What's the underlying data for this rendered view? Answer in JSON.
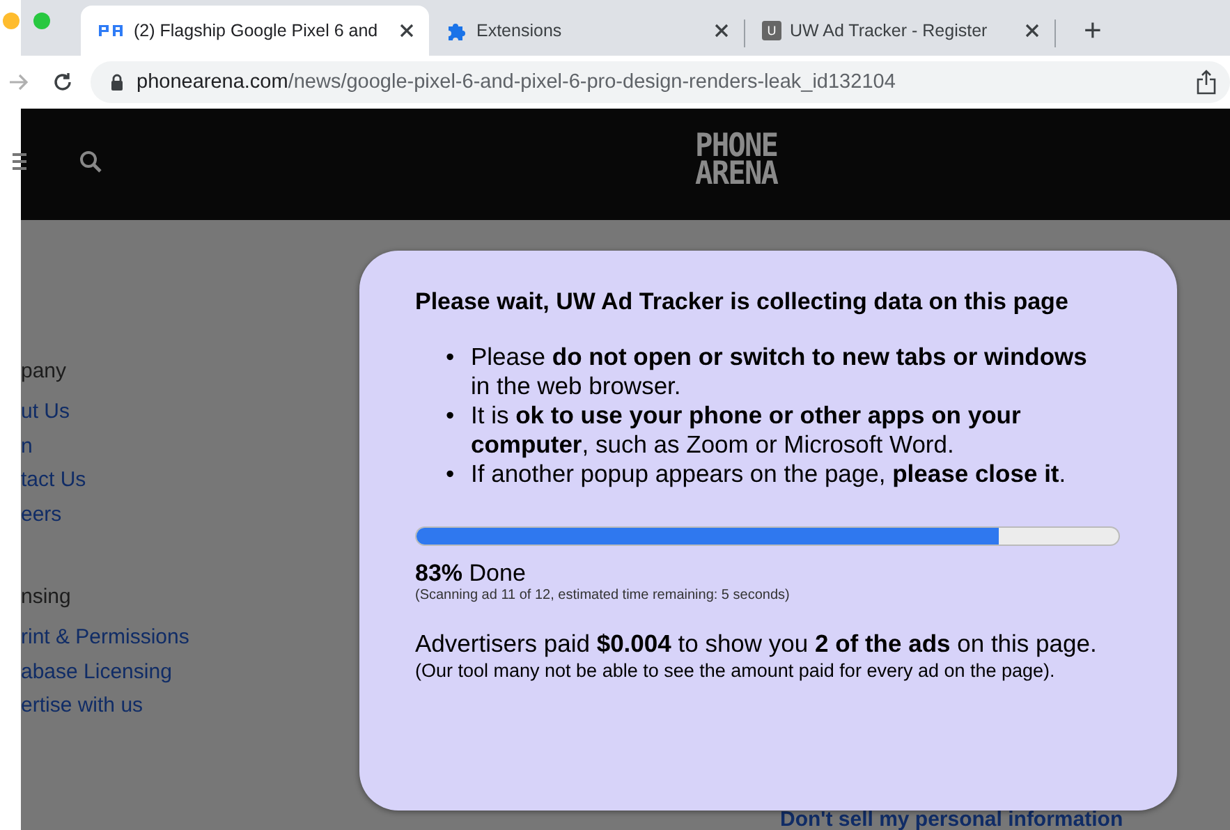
{
  "browser": {
    "window_buttons": [
      {
        "color": "#febc2e"
      },
      {
        "color": "#28c840"
      }
    ],
    "tabs": [
      {
        "title": "(2) Flagship Google Pixel 6 and",
        "selected": true,
        "kind": "site"
      },
      {
        "title": "Extensions",
        "selected": false,
        "kind": "extensions"
      },
      {
        "title": "UW Ad Tracker - Register",
        "selected": false,
        "kind": "letter",
        "badge": "U"
      }
    ],
    "new_tab": "+",
    "address": {
      "host": "phonearena.com",
      "path": "/news/google-pixel-6-and-pixel-6-pro-design-renders-leak_id132104"
    }
  },
  "site": {
    "logo": [
      "PHONE",
      "ARENA"
    ],
    "sidebar": [
      {
        "heading": "pany",
        "links": [
          "ut Us",
          "n",
          "tact Us",
          "eers"
        ]
      },
      {
        "heading": "nsing",
        "links": [
          "rint & Permissions",
          "abase Licensing",
          "ertise with us"
        ]
      }
    ],
    "footer_link": "Don't sell my personal information"
  },
  "popup": {
    "title": "Please wait, UW Ad Tracker is collecting data on this page",
    "marker": "•",
    "bullets": [
      "Please **do not open or switch to new tabs or windows** in the web browser.",
      "It is **ok to use your phone or other apps on your computer**, such as Zoom or Microsoft Word.",
      "If another popup appears on the page, **please close it**."
    ],
    "progress": {
      "level": 0.83
    },
    "status": "**83%** Done",
    "detail": "(Scanning ad 11 of 12, estimated time remaining: 5 seconds)",
    "summary": "Advertisers paid **$0.004** to show you **2 of the ads** on this page.",
    "note": "(Our tool many not be able to see the amount paid for every ad on the page)."
  }
}
